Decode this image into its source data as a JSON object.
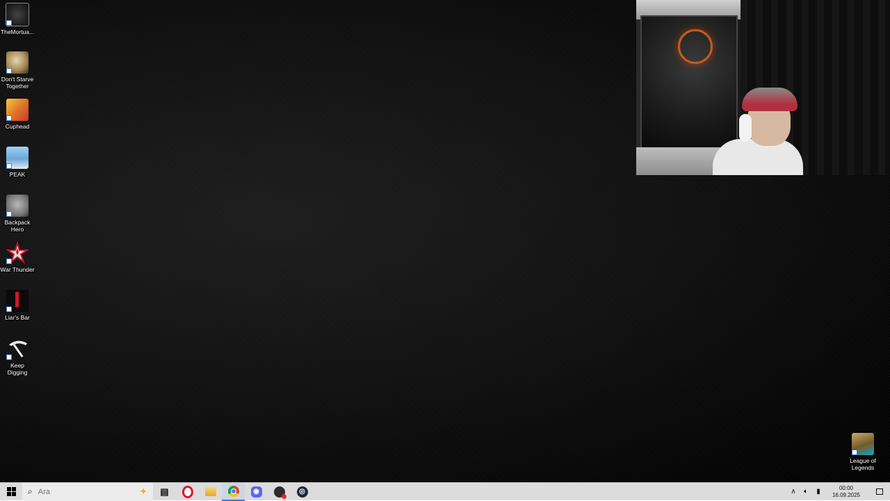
{
  "desktop": {
    "icons": [
      {
        "label": "TheMortua...",
        "icon": "the-mortuary-assistant-icon"
      },
      {
        "label": "Don't Starve Together",
        "icon": "dont-starve-together-icon"
      },
      {
        "label": "Cuphead",
        "icon": "cuphead-icon"
      },
      {
        "label": "PEAK",
        "icon": "peak-icon"
      },
      {
        "label": "Backpack Hero",
        "icon": "backpack-hero-icon"
      },
      {
        "label": "War Thunder",
        "icon": "war-thunder-icon"
      },
      {
        "label": "Liar's Bar",
        "icon": "liars-bar-icon"
      },
      {
        "label": "Keep Digging",
        "icon": "keep-digging-icon"
      }
    ],
    "corner_icon": {
      "label": "League of Legends",
      "icon": "league-of-legends-icon"
    }
  },
  "webcam": {
    "description_icon": "webcam-overlay"
  },
  "taskbar": {
    "search_placeholder": "Ara",
    "apps": [
      {
        "icon": "task-view-icon"
      },
      {
        "icon": "opera-icon"
      },
      {
        "icon": "file-explorer-icon"
      },
      {
        "icon": "chrome-icon",
        "active": true
      },
      {
        "icon": "discord-icon"
      },
      {
        "icon": "obs-icon"
      },
      {
        "icon": "steam-icon"
      }
    ],
    "tray": {
      "time": "00:00",
      "date": "16.09.2025"
    }
  },
  "colors": {
    "taskbar_bg": "#dcdcdc",
    "active_indicator": "#3a7bd5",
    "desktop_bg": "#101010"
  }
}
